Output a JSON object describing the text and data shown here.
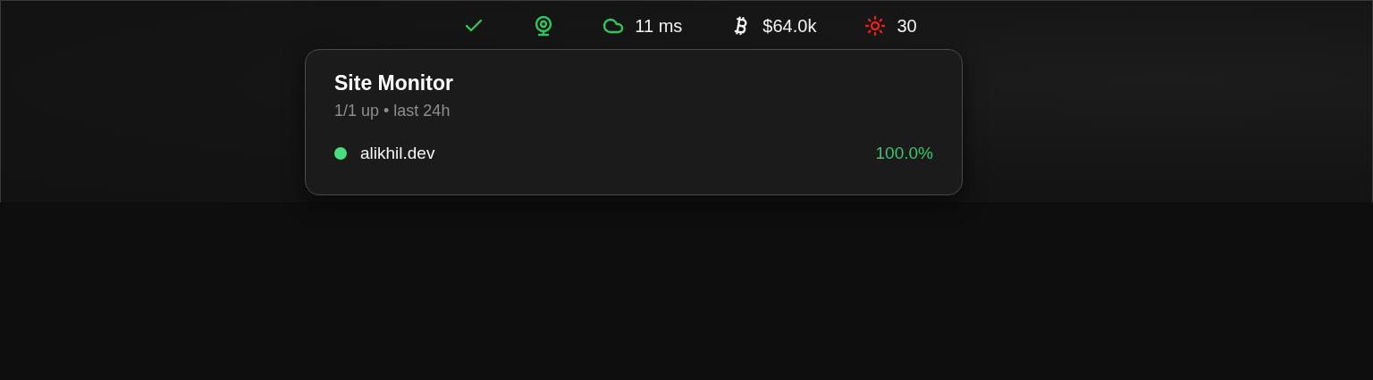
{
  "menu_bar": {
    "items": [
      {
        "kind": "check"
      },
      {
        "kind": "webcam"
      },
      {
        "kind": "cloud",
        "text": "11 ms"
      },
      {
        "kind": "bitcoin",
        "text": "$64.0k"
      },
      {
        "kind": "sun",
        "text": "30"
      }
    ]
  },
  "popover": {
    "title": "Site Monitor",
    "subtitle": "1/1 up • last 24h",
    "sites": [
      {
        "name": "alikhil.dev",
        "up": true,
        "uptime": "100.0%"
      }
    ]
  }
}
